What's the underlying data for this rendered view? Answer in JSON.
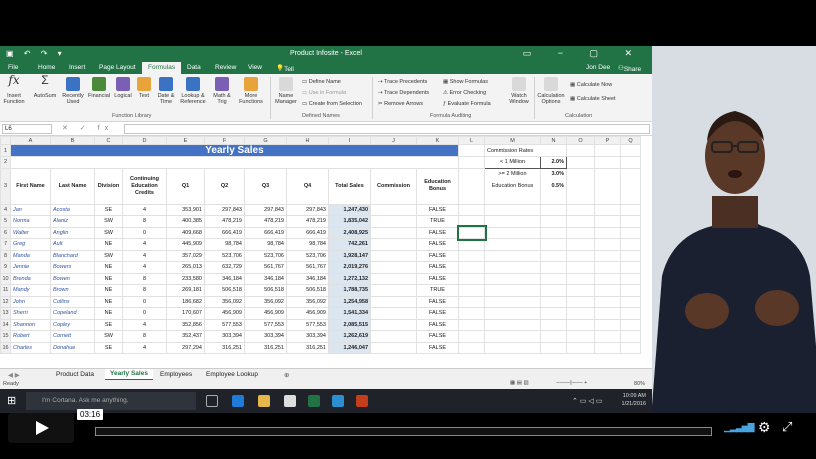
{
  "window": {
    "title": "Product Infosite - Excel",
    "user": "Jon Dee",
    "share": "Share"
  },
  "tabs": [
    "File",
    "Home",
    "Insert",
    "Page Layout",
    "Formulas",
    "Data",
    "Review",
    "View"
  ],
  "tellme": "Tell me what you want to do...",
  "ribbon": {
    "insert_function": "Insert Function",
    "autosum": "AutoSum",
    "recently_used": "Recently Used",
    "financial": "Financial",
    "logical": "Logical",
    "text": "Text",
    "date_time": "Date & Time",
    "lookup": "Lookup & Reference",
    "math": "Math & Trig",
    "more": "More Functions",
    "group_fl": "Function Library",
    "name_manager": "Name Manager",
    "define_name": "Define Name",
    "use_in_formula": "Use in Formula",
    "create_from_selection": "Create from Selection",
    "group_dn": "Defined Names",
    "trace_precedents": "Trace Precedents",
    "trace_dependents": "Trace Dependents",
    "remove_arrows": "Remove Arrows",
    "show_formulas": "Show Formulas",
    "error_checking": "Error Checking",
    "evaluate_formula": "Evaluate Formula",
    "watch_window": "Watch Window",
    "group_fa": "Formula Auditing",
    "calc_options": "Calculation Options",
    "calc_now": "Calculate Now",
    "calc_sheet": "Calculate Sheet",
    "group_calc": "Calculation"
  },
  "namebox": "L6",
  "columns": [
    "A",
    "B",
    "C",
    "D",
    "E",
    "F",
    "G",
    "H",
    "I",
    "J",
    "K",
    "L",
    "M",
    "N",
    "O",
    "P",
    "Q"
  ],
  "sheet_title": "Yearly Sales",
  "headers": [
    "First Name",
    "Last Name",
    "Division",
    "Continuing Education Credits",
    "Q1",
    "Q2",
    "Q3",
    "Q4",
    "Total Sales",
    "Commission",
    "Education Bonus"
  ],
  "rows": [
    [
      "Jan",
      "Acosta",
      "SE",
      "4",
      "353,901",
      "297,843",
      "297,843",
      "297,843",
      "1,247,430",
      "",
      "FALSE"
    ],
    [
      "Norma",
      "Alaniz",
      "SW",
      "8",
      "400,385",
      "478,219",
      "478,219",
      "478,219",
      "1,835,042",
      "",
      "TRUE"
    ],
    [
      "Walter",
      "Anglin",
      "SW",
      "0",
      "409,668",
      "666,419",
      "666,419",
      "666,419",
      "2,408,925",
      "",
      "FALSE"
    ],
    [
      "Greg",
      "Ault",
      "NE",
      "4",
      "445,909",
      "98,784",
      "98,784",
      "98,784",
      "742,261",
      "",
      "FALSE"
    ],
    [
      "Manda",
      "Blanchard",
      "SW",
      "4",
      "357,029",
      "523,706",
      "523,706",
      "523,706",
      "1,928,147",
      "",
      "FALSE"
    ],
    [
      "Jennie",
      "Bowers",
      "NE",
      "4",
      "265,013",
      "632,729",
      "561,767",
      "561,767",
      "2,019,276",
      "",
      "FALSE"
    ],
    [
      "Brenda",
      "Bowen",
      "NE",
      "8",
      "233,580",
      "346,184",
      "346,184",
      "346,184",
      "1,272,132",
      "",
      "FALSE"
    ],
    [
      "Mandy",
      "Brown",
      "NE",
      "8",
      "269,181",
      "506,518",
      "506,518",
      "506,518",
      "1,788,735",
      "",
      "TRUE"
    ],
    [
      "John",
      "Collins",
      "NE",
      "0",
      "186,682",
      "356,092",
      "356,092",
      "356,092",
      "1,254,958",
      "",
      "FALSE"
    ],
    [
      "Sherri",
      "Copeland",
      "NE",
      "0",
      "170,607",
      "456,909",
      "456,909",
      "456,909",
      "1,541,334",
      "",
      "FALSE"
    ],
    [
      "Shannon",
      "Copley",
      "SE",
      "4",
      "352,856",
      "577,553",
      "577,553",
      "577,553",
      "2,085,515",
      "",
      "FALSE"
    ],
    [
      "Robert",
      "Cornett",
      "SW",
      "8",
      "352,437",
      "303,394",
      "303,394",
      "303,394",
      "1,262,619",
      "",
      "FALSE"
    ],
    [
      "Charles",
      "Donahue",
      "SE",
      "4",
      "297,294",
      "316,251",
      "316,251",
      "316,251",
      "1,246,047",
      "",
      "FALSE"
    ]
  ],
  "rates": {
    "title": "Commission Rates",
    "r1_label": "< 1 Million",
    "r1_val": "2.0%",
    "r2_label": ">= 2 Million",
    "r2_val": "3.0%",
    "r3_label": "Education Bonus",
    "r3_val": "0.5%"
  },
  "sheets": [
    "Product Data",
    "Yearly Sales",
    "Employees",
    "Employee Lookup"
  ],
  "status": {
    "ready": "Ready",
    "zoom": "80%"
  },
  "taskbar": {
    "search": "I'm Cortana. Ask me anything.",
    "time": "10:09 AM",
    "date": "1/21/2016"
  },
  "player": {
    "time": "03:16"
  }
}
